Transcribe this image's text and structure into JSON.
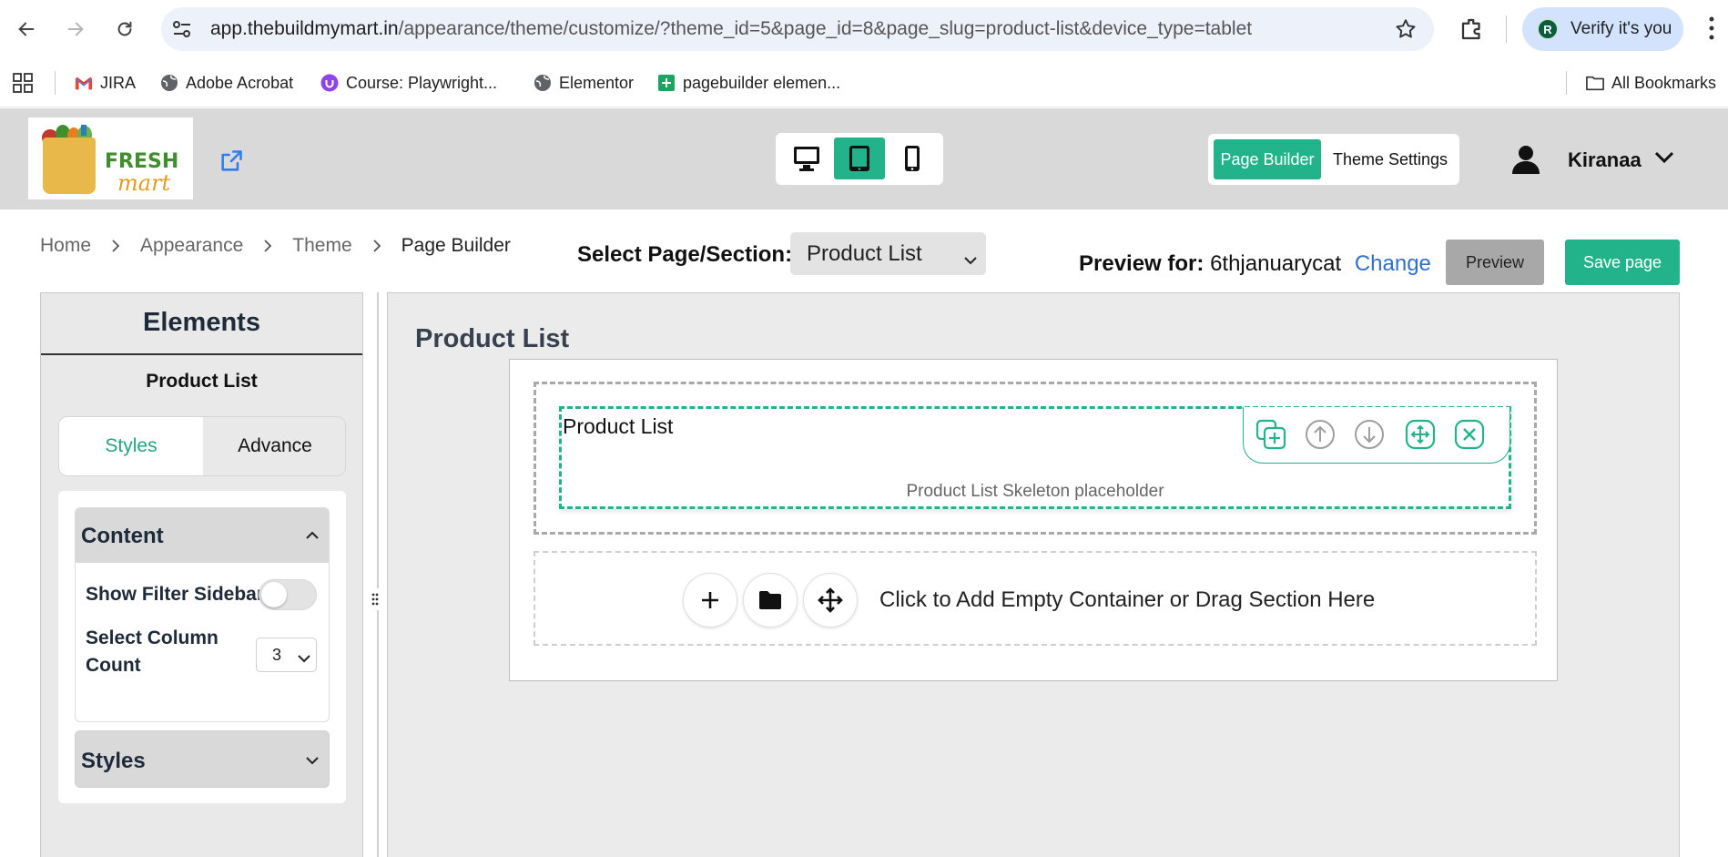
{
  "browser": {
    "url_host": "app.thebuildmymart.in",
    "url_path": "/appearance/theme/customize/?theme_id=5&page_id=8&page_slug=product-list&device_type=tablet",
    "verify_label": "Verify it's you",
    "avatar_letter": "R",
    "bookmarks": [
      {
        "label": "JIRA",
        "icon": "gmail-icon"
      },
      {
        "label": "Adobe Acrobat",
        "icon": "globe-icon"
      },
      {
        "label": "Course: Playwright...",
        "icon": "udemy-icon"
      },
      {
        "label": "Elementor",
        "icon": "globe-icon"
      },
      {
        "label": "pagebuilder elemen...",
        "icon": "sheets-icon"
      }
    ],
    "all_bookmarks_label": "All Bookmarks"
  },
  "header": {
    "logo_fresh": "FRESH",
    "logo_mart": "mart",
    "devices": [
      "desktop",
      "tablet",
      "mobile"
    ],
    "active_device": "tablet",
    "mode_page_builder": "Page Builder",
    "mode_theme_settings": "Theme Settings",
    "user_name": "Kiranaa"
  },
  "breadcrumb": {
    "home": "Home",
    "appearance": "Appearance",
    "theme": "Theme",
    "current": "Page Builder"
  },
  "toolbar": {
    "select_label": "Select Page/Section:",
    "select_value": "Product List",
    "preview_for_label": "Preview for:",
    "preview_for_value": "6thjanuarycat",
    "change_label": "Change",
    "preview_button": "Preview",
    "save_button": "Save page"
  },
  "left_panel": {
    "title": "Elements",
    "subtitle": "Product List",
    "tabs": {
      "styles": "Styles",
      "advance": "Advance"
    },
    "content_section": {
      "title": "Content",
      "show_filter_label": "Show Filter Sidebar",
      "show_filter_enabled": false,
      "column_count_label_1": "Select Column",
      "column_count_label_2": "Count",
      "column_count_value": "3"
    },
    "styles_section": {
      "title": "Styles"
    }
  },
  "canvas": {
    "title": "Product List",
    "element_title": "Product List",
    "placeholder": "Product List Skeleton placeholder",
    "add_text": "Click to Add Empty Container or Drag Section Here"
  },
  "colors": {
    "accent": "#22b38a",
    "header_bg": "#d9d9d9",
    "link": "#2f6fcf"
  }
}
